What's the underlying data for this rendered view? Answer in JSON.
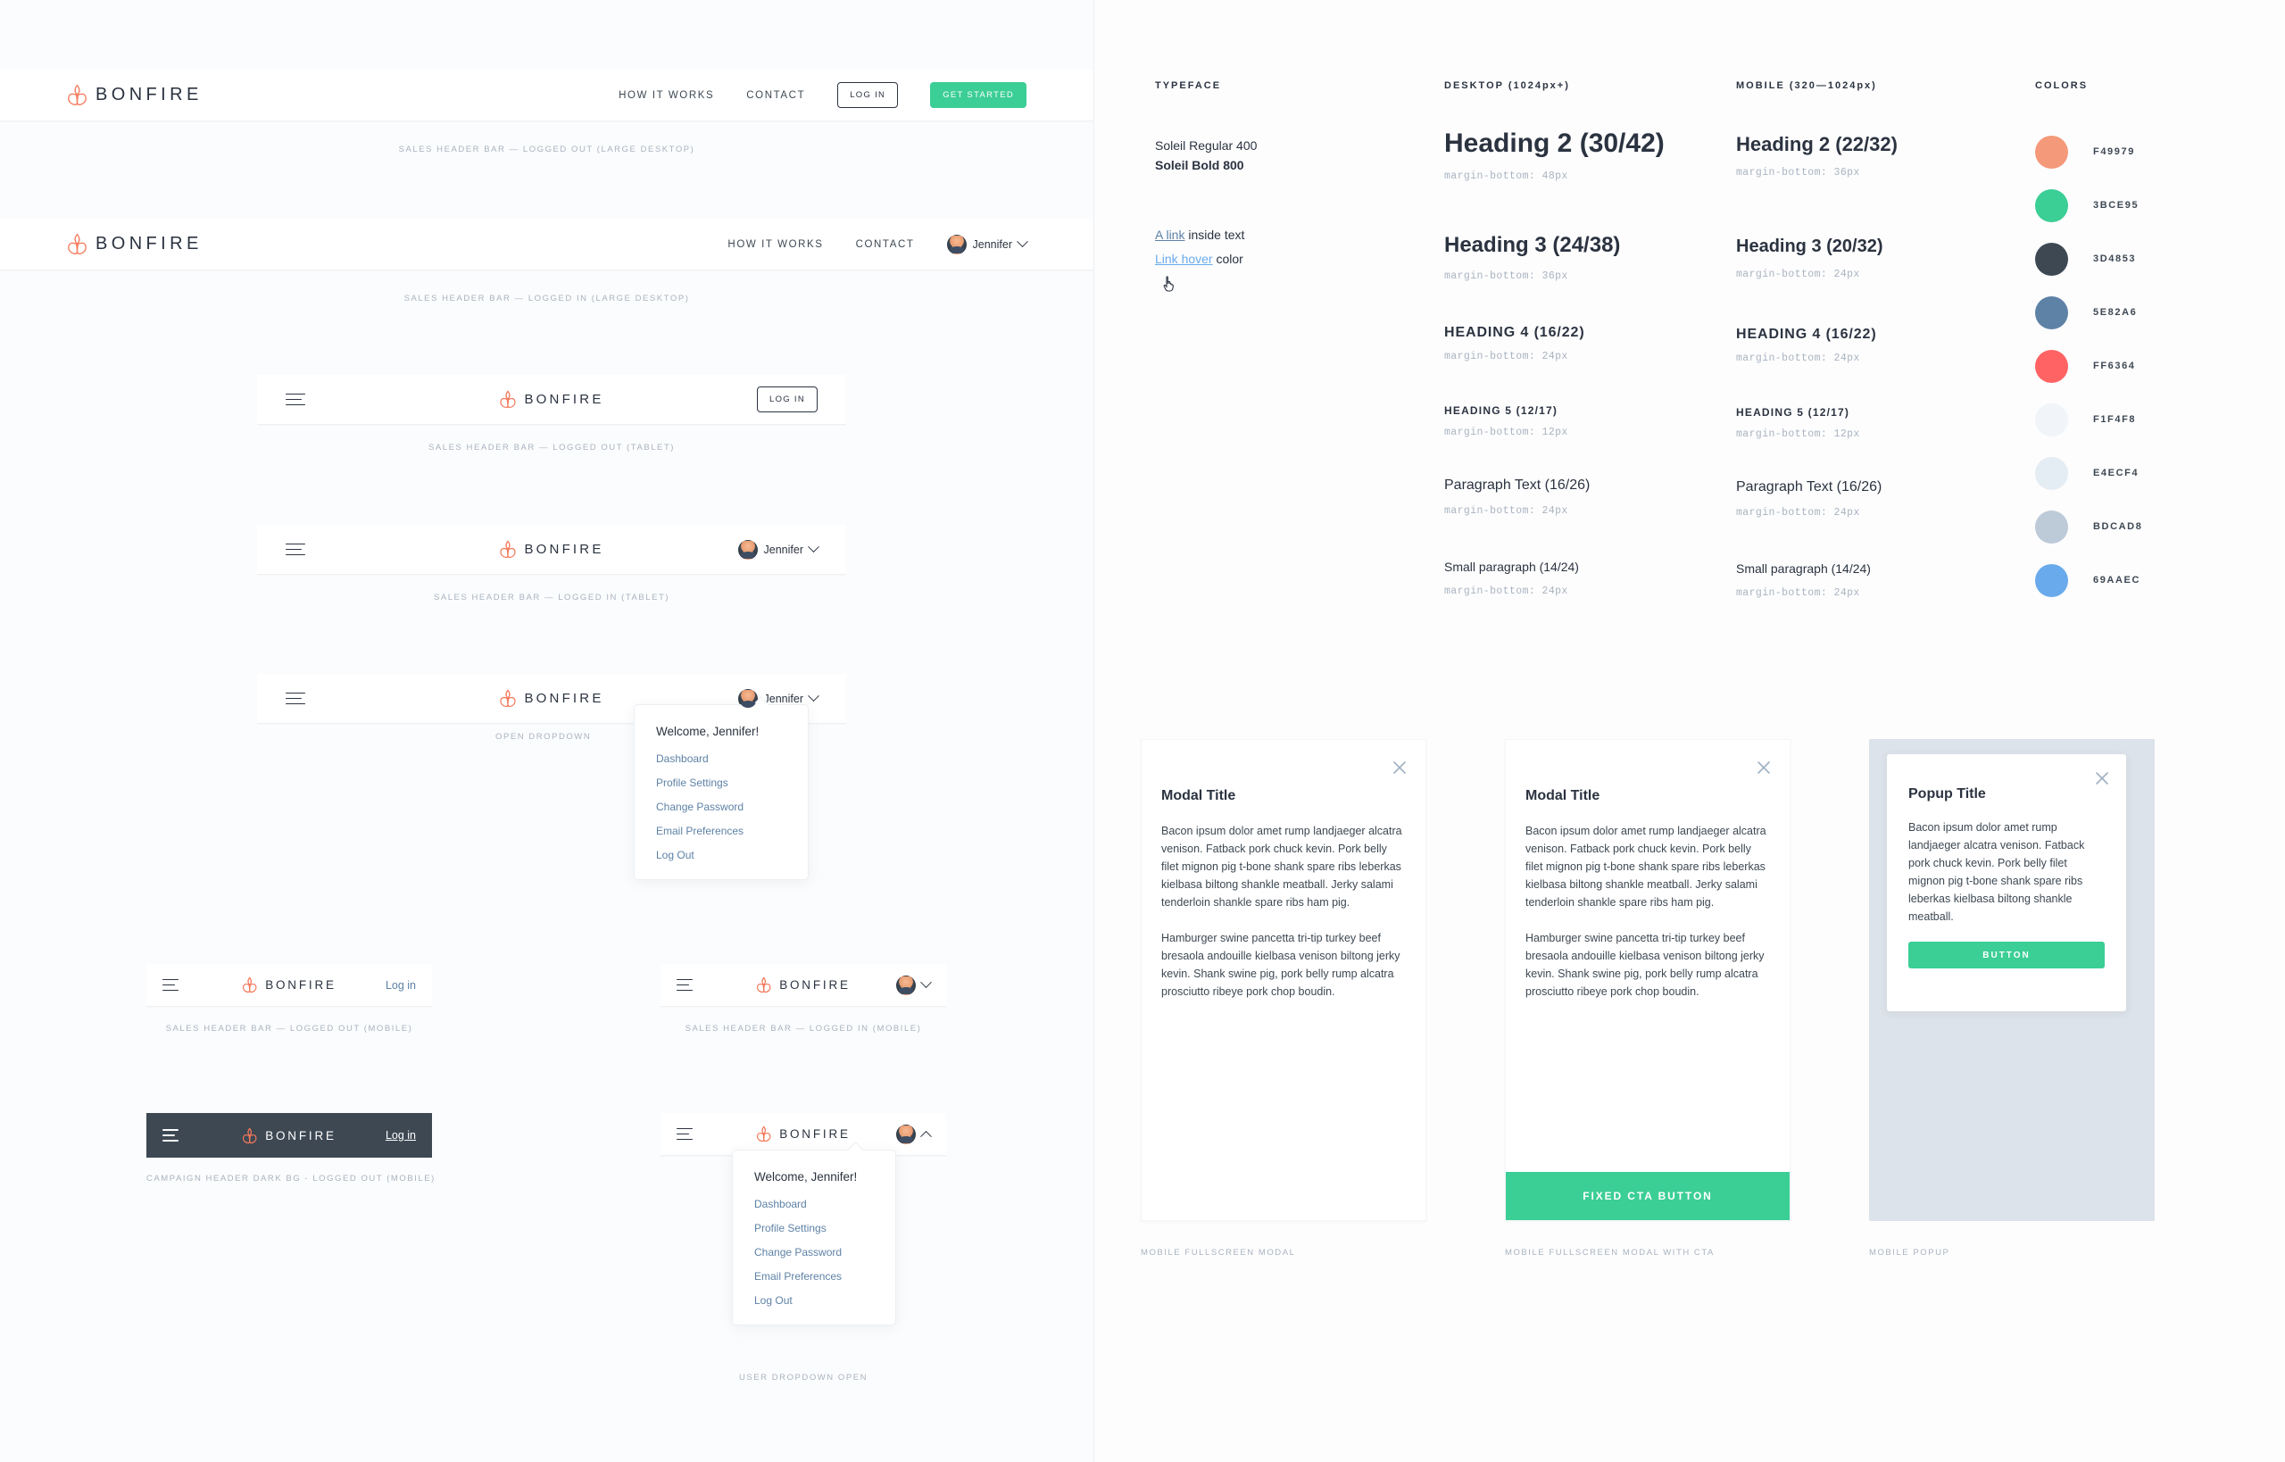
{
  "brand": {
    "name": "BONFIRE",
    "logo_icon": "bonfire-flame-icon",
    "accent_orange": "#F4785A",
    "accent_green": "#3BCE95",
    "dark": "#3D4853",
    "link_blue": "#5E82A6",
    "link_hover_blue": "#69AAEC"
  },
  "headers": {
    "nav": {
      "how_it_works": "HOW IT WORKS",
      "contact": "CONTACT"
    },
    "log_in_caps": "LOG IN",
    "get_started": "GET STARTED",
    "log_in_plain": "Log in",
    "user_name": "Jennifer",
    "captions": {
      "desktop_logged_out": "SALES HEADER BAR — LOGGED OUT (LARGE DESKTOP)",
      "desktop_logged_in": "SALES HEADER BAR — LOGGED IN (LARGE DESKTOP)",
      "tablet_logged_out": "SALES HEADER BAR — LOGGED OUT (TABLET)",
      "tablet_logged_in": "SALES HEADER BAR — LOGGED IN (TABLET)",
      "open_dropdown": "OPEN DROPDOWN",
      "mobile_logged_out": "SALES HEADER BAR — LOGGED OUT (MOBILE)",
      "mobile_logged_in": "SALES HEADER BAR — LOGGED IN (MOBILE)",
      "campaign_dark": "CAMPAIGN HEADER DARK BG - LOGGED OUT (MOBILE)",
      "user_dropdown_open": "USER DROPDOWN OPEN"
    }
  },
  "dropdown": {
    "welcome": "Welcome, Jennifer!",
    "items": [
      {
        "label": "Dashboard"
      },
      {
        "label": "Profile Settings"
      },
      {
        "label": "Change Password"
      },
      {
        "label": "Email Preferences"
      },
      {
        "label": "Log Out"
      }
    ]
  },
  "typography": {
    "section_label": "TYPEFACE",
    "faces": [
      {
        "label": "Soleil Regular 400",
        "weight": "regular"
      },
      {
        "label": "Soleil Bold 800",
        "weight": "bold"
      }
    ],
    "link_sample": {
      "link": "A link",
      "rest": " inside text"
    },
    "link_hover_sample": {
      "link": "Link hover",
      "rest": " color"
    },
    "columns": [
      {
        "label": "DESKTOP (1024px+)",
        "rows": [
          {
            "style": "h2",
            "text": "Heading 2 (30/42)",
            "margin": "margin-bottom: 48px"
          },
          {
            "style": "h3",
            "text": "Heading 3 (24/38)",
            "margin": "margin-bottom: 36px"
          },
          {
            "style": "h4",
            "text": "HEADING 4 (16/22)",
            "margin": "margin-bottom: 24px"
          },
          {
            "style": "h5",
            "text": "HEADING 5 (12/17)",
            "margin": "margin-bottom: 12px"
          },
          {
            "style": "p",
            "text": "Paragraph Text (16/26)",
            "margin": "margin-bottom: 24px"
          },
          {
            "style": "sp",
            "text": "Small paragraph (14/24)",
            "margin": "margin-bottom: 24px"
          }
        ]
      },
      {
        "label": "MOBILE (320—1024px)",
        "rows": [
          {
            "style": "h2",
            "text": "Heading 2 (22/32)",
            "margin": "margin-bottom: 36px"
          },
          {
            "style": "h3",
            "text": "Heading 3 (20/32)",
            "margin": "margin-bottom: 24px"
          },
          {
            "style": "h4",
            "text": "HEADING 4 (16/22)",
            "margin": "margin-bottom: 24px"
          },
          {
            "style": "h5",
            "text": "HEADING 5 (12/17)",
            "margin": "margin-bottom: 12px"
          },
          {
            "style": "p",
            "text": "Paragraph Text (16/26)",
            "margin": "margin-bottom: 24px"
          },
          {
            "style": "sp",
            "text": "Small paragraph (14/24)",
            "margin": "margin-bottom: 24px"
          }
        ]
      }
    ]
  },
  "colors": {
    "section_label": "COLORS",
    "swatches": [
      {
        "hex_label": "F49979",
        "hex": "#F49979"
      },
      {
        "hex_label": "3BCE95",
        "hex": "#3BCE95"
      },
      {
        "hex_label": "3D4853",
        "hex": "#3D4853"
      },
      {
        "hex_label": "5E82A6",
        "hex": "#5E82A6"
      },
      {
        "hex_label": "FF6364",
        "hex": "#FF6364"
      },
      {
        "hex_label": "F1F4F8",
        "hex": "#F1F4F8"
      },
      {
        "hex_label": "E4ECF4",
        "hex": "#E4ECF4"
      },
      {
        "hex_label": "BDCAD8",
        "hex": "#BDCAD8"
      },
      {
        "hex_label": "69AAEC",
        "hex": "#69AAEC"
      }
    ]
  },
  "modals": {
    "modal_title": "Modal Title",
    "popup_title": "Popup Title",
    "paragraph_1": "Bacon ipsum dolor amet rump landjaeger alcatra venison. Fatback pork chuck kevin. Pork belly filet mignon pig t-bone shank spare ribs leberkas kielbasa biltong shankle meatball. Jerky salami tenderloin shankle spare ribs ham pig.",
    "paragraph_2": "Hamburger swine pancetta tri-tip turkey beef bresaola andouille kielbasa venison biltong jerky kevin. Shank swine pig, pork belly rump alcatra prosciutto ribeye pork chop boudin.",
    "popup_paragraph": "Bacon ipsum dolor amet rump landjaeger alcatra venison. Fatback pork chuck kevin. Pork belly filet mignon pig t-bone shank spare ribs leberkas kielbasa biltong shankle meatball.",
    "cta_label": "FIXED CTA BUTTON",
    "popup_button": "BUTTON",
    "captions": {
      "fullscreen": "MOBILE FULLSCREEN MODAL",
      "fullscreen_cta": "MOBILE FULLSCREEN MODAL WITH CTA",
      "popup": "MOBILE POPUP"
    }
  }
}
